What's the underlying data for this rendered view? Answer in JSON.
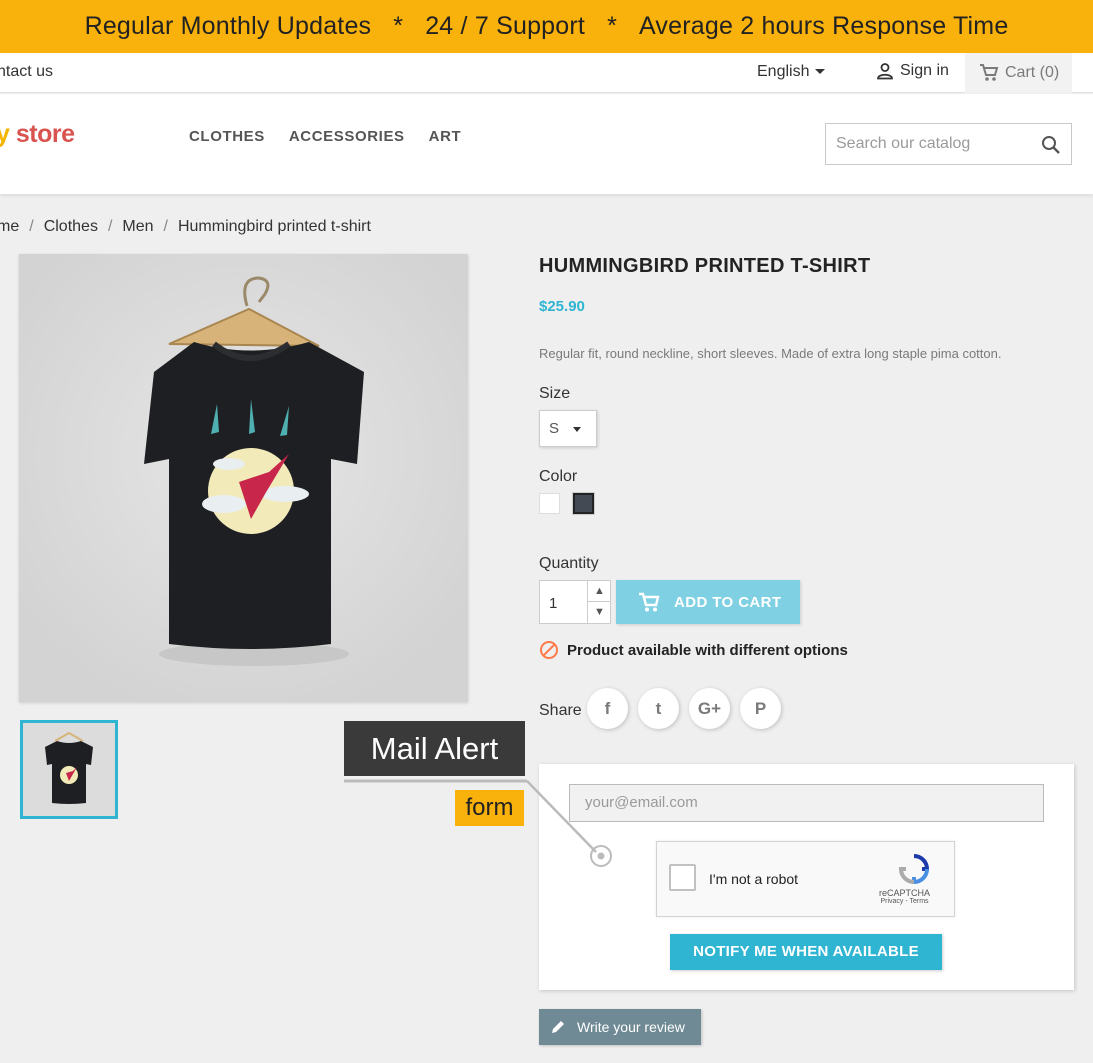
{
  "promo": {
    "part1": "Regular Monthly Updates",
    "sep": "*",
    "part2": "24 / 7 Support",
    "part3": "Average 2 hours Response Time"
  },
  "nav": {
    "contact": "ntact us",
    "language": "English",
    "signin": "Sign in",
    "cart": "Cart (0)"
  },
  "header": {
    "logo_a": "y",
    "logo_b": " store",
    "menu": [
      "CLOTHES",
      "ACCESSORIES",
      "ART"
    ],
    "search_placeholder": "Search our catalog"
  },
  "breadcrumb": [
    "me",
    "Clothes",
    "Men",
    "Hummingbird printed t-shirt"
  ],
  "breadcrumb_sep": "/",
  "product": {
    "title": "HUMMINGBIRD PRINTED T-SHIRT",
    "price": "$25.90",
    "description": "Regular fit, round neckline, short sleeves. Made of extra long staple pima cotton.",
    "size_label": "Size",
    "size_value": "S",
    "color_label": "Color",
    "colors": [
      "#ffffff",
      "#434a54"
    ],
    "quantity_label": "Quantity",
    "quantity": "1",
    "add_to_cart": "ADD TO CART",
    "availability": "Product available with different options",
    "share_label": "Share",
    "share": [
      "f",
      "t",
      "G+",
      "P"
    ]
  },
  "callout": {
    "title": "Mail Alert",
    "tag": "form"
  },
  "alert": {
    "email_placeholder": "your@email.com",
    "captcha_text": "I'm not a robot",
    "captcha_brand": "reCAPTCHA",
    "captcha_links": "Privacy - Terms",
    "notify": "NOTIFY ME WHEN AVAILABLE"
  },
  "review": "Write your review",
  "colors": {
    "banner": "#f9b10c",
    "accent": "#2fb5d2",
    "add_to_cart_disabled": "#7fd0e2"
  }
}
